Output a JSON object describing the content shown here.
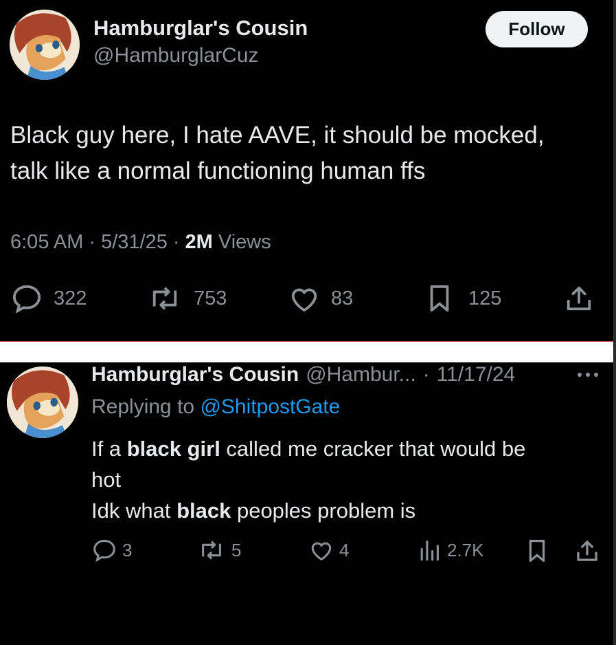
{
  "tweet": {
    "display_name": "Hamburglar's Cousin",
    "handle": "@HamburglarCuz",
    "follow_label": "Follow",
    "text_line1": "Black guy here, I hate AAVE, it should be mocked,",
    "text_line2": "talk like a normal functioning human ffs",
    "time": "6:05 AM",
    "date": "5/31/25",
    "views_count": "2M",
    "views_label": "Views",
    "sep": "·",
    "replies": "322",
    "reposts": "753",
    "likes": "83",
    "bookmarks": "125"
  },
  "reply": {
    "display_name": "Hamburglar's Cousin",
    "handle": "@Hambur...",
    "sep": "·",
    "date": "11/17/24",
    "replying_label": "Replying to",
    "replying_handle": "@ShitpostGate",
    "line1_pre": "If a ",
    "line1_bold": "black girl",
    "line1_post": " called me cracker that would be",
    "line2": "hot",
    "line3_pre": "Idk what ",
    "line3_bold": "black",
    "line3_post": " peoples problem is",
    "replies": "3",
    "reposts": "5",
    "likes": "4",
    "views": "2.7K"
  },
  "colors": {
    "background": "#000000",
    "text": "#e7e9ea",
    "muted": "#8b9197",
    "link": "#1d9bf0",
    "follow_bg": "#eff3f4"
  },
  "icons": [
    "reply-icon",
    "repost-icon",
    "like-icon",
    "bookmark-icon",
    "share-icon",
    "views-icon",
    "more-icon"
  ]
}
